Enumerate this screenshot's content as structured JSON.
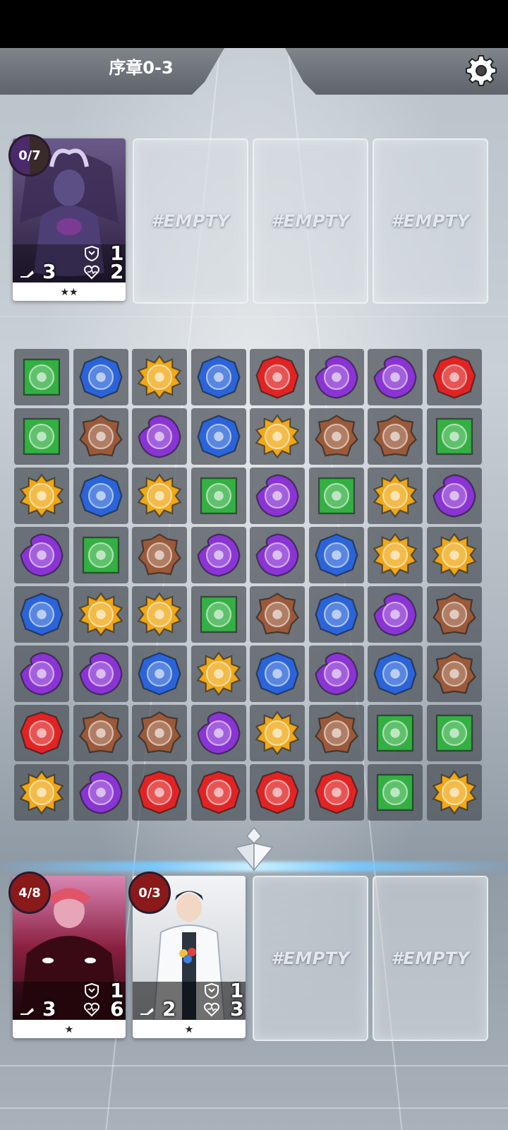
{
  "header": {
    "stage_title": "序章0-3",
    "settings_icon": "gear-icon"
  },
  "enemy": {
    "cards": [
      {
        "type": "hero",
        "charge": "0/7",
        "stars": "★★",
        "attack_value": "3",
        "defense_value": "1",
        "health_value": "2",
        "charge_color": "#4a2a6a"
      },
      {
        "type": "empty",
        "label": "#EMPTY"
      },
      {
        "type": "empty",
        "label": "#EMPTY"
      },
      {
        "type": "empty",
        "label": "#EMPTY"
      }
    ]
  },
  "board": {
    "rows": [
      [
        "green",
        "blue",
        "yellow",
        "blue",
        "red",
        "purple",
        "purple",
        "red"
      ],
      [
        "green",
        "brown",
        "purple",
        "blue",
        "yellow",
        "brown",
        "brown",
        "green"
      ],
      [
        "yellow",
        "blue",
        "yellow",
        "green",
        "purple",
        "green",
        "yellow",
        "purple"
      ],
      [
        "purple",
        "green",
        "brown",
        "purple",
        "purple",
        "blue",
        "yellow",
        "yellow"
      ],
      [
        "blue",
        "yellow",
        "yellow",
        "green",
        "brown",
        "blue",
        "purple",
        "brown"
      ],
      [
        "purple",
        "purple",
        "blue",
        "yellow",
        "blue",
        "purple",
        "blue",
        "brown"
      ],
      [
        "red",
        "brown",
        "brown",
        "purple",
        "yellow",
        "brown",
        "green",
        "green"
      ],
      [
        "yellow",
        "purple",
        "red",
        "red",
        "red",
        "red",
        "green",
        "yellow"
      ]
    ],
    "gem_colors": {
      "green": "#34b043",
      "blue": "#2a64d8",
      "yellow": "#f0a818",
      "red": "#e02424",
      "purple": "#8a34d4",
      "brown": "#9a5a3a"
    }
  },
  "player": {
    "cards": [
      {
        "type": "hero",
        "charge": "4/8",
        "stars": "★",
        "attack_value": "3",
        "defense_value": "1",
        "health_value": "6",
        "charge_color": "#8a1a1a"
      },
      {
        "type": "hero",
        "charge": "0/3",
        "stars": "★",
        "attack_value": "2",
        "defense_value": "1",
        "health_value": "3",
        "charge_color": "#8a1a1a"
      },
      {
        "type": "empty",
        "label": "#EMPTY"
      },
      {
        "type": "empty",
        "label": "#EMPTY"
      }
    ]
  }
}
